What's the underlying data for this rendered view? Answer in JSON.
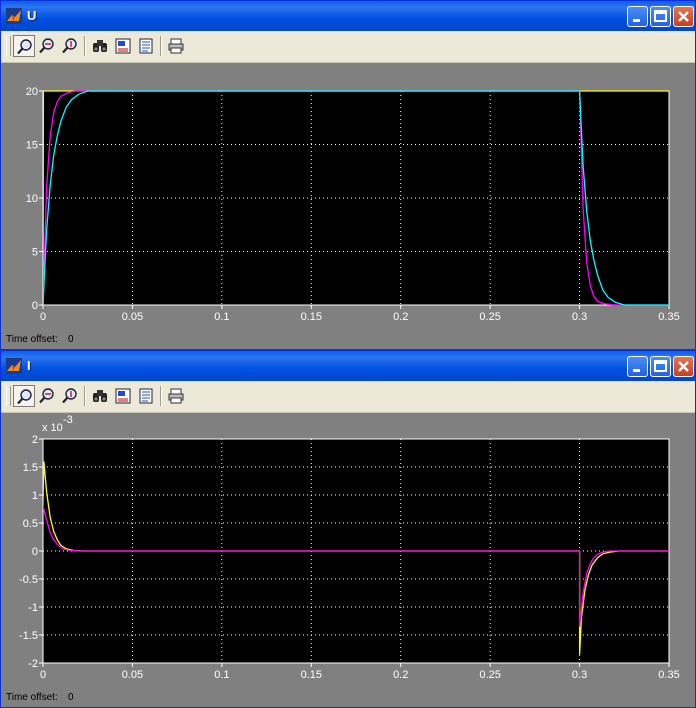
{
  "windows": [
    {
      "title": "U",
      "toolbar": [
        "zoom-icon",
        "zoom-x-icon",
        "zoom-y-icon",
        "autoscale-icon",
        "save-axes-icon",
        "parameters-icon",
        "print-icon"
      ],
      "time_offset_label": "Time offset:",
      "time_offset_value": "0"
    },
    {
      "title": "I",
      "toolbar": [
        "zoom-icon",
        "zoom-x-icon",
        "zoom-y-icon",
        "autoscale-icon",
        "save-axes-icon",
        "parameters-icon",
        "print-icon"
      ],
      "time_offset_label": "Time offset:",
      "time_offset_value": "0"
    }
  ],
  "colors": {
    "bg": "#000000",
    "grid": "#ffffff",
    "yellow": "#ffff00",
    "magenta": "#ff00ff",
    "cyan": "#00ffff"
  },
  "chart_data": [
    {
      "type": "line",
      "title": "U",
      "xlim": [
        0,
        0.35
      ],
      "ylim": [
        0,
        20
      ],
      "xticks": [
        0,
        0.05,
        0.1,
        0.15,
        0.2,
        0.25,
        0.3,
        0.35
      ],
      "xtick_labels": [
        "0",
        "0.05",
        "0.1",
        "0.15",
        "0.2",
        "0.25",
        "0.3",
        "0.35"
      ],
      "yticks": [
        0,
        5,
        10,
        15,
        20
      ],
      "ytick_labels": [
        "0",
        "5",
        "10",
        "15",
        "20"
      ],
      "grid": true,
      "series": [
        {
          "color": "#ffff00",
          "x": [
            0,
            0.0002,
            0.3,
            0.3,
            0.35
          ],
          "y": [
            0,
            20,
            20,
            20,
            20
          ]
        },
        {
          "color": "#ff00ff",
          "x": [
            0,
            0.002,
            0.004,
            0.006,
            0.008,
            0.01,
            0.014,
            0.018,
            0.3,
            0.302,
            0.304,
            0.306,
            0.308,
            0.31,
            0.314,
            0.318,
            0.322,
            0.35
          ],
          "y": [
            0,
            11,
            15.8,
            18,
            19,
            19.5,
            19.85,
            20,
            20,
            9,
            4,
            1.8,
            0.8,
            0.35,
            0.1,
            0.03,
            0,
            0
          ]
        },
        {
          "color": "#00ffff",
          "x": [
            0,
            0.002,
            0.004,
            0.006,
            0.008,
            0.01,
            0.013,
            0.016,
            0.02,
            0.025,
            0.3,
            0.302,
            0.304,
            0.306,
            0.308,
            0.31,
            0.313,
            0.316,
            0.32,
            0.325,
            0.35
          ],
          "y": [
            0,
            7,
            11.2,
            14,
            15.8,
            17.2,
            18.5,
            19.2,
            19.7,
            20,
            20,
            13,
            8.8,
            6,
            4.2,
            2.8,
            1.4,
            0.7,
            0.25,
            0,
            0
          ]
        }
      ]
    },
    {
      "type": "line",
      "title": "I",
      "xlim": [
        0,
        0.35
      ],
      "ylim": [
        -2,
        2
      ],
      "exponent_label": "x 10",
      "exponent_power": "-3",
      "xticks": [
        0,
        0.05,
        0.1,
        0.15,
        0.2,
        0.25,
        0.3,
        0.35
      ],
      "xtick_labels": [
        "0",
        "0.05",
        "0.1",
        "0.15",
        "0.2",
        "0.25",
        "0.3",
        "0.35"
      ],
      "yticks": [
        2,
        1.5,
        1,
        0.5,
        0,
        -0.5,
        -1,
        -1.5,
        -2
      ],
      "ytick_labels": [
        "2",
        "1.5",
        "1",
        "0.5",
        "0",
        "-0.5",
        "-1",
        "-1.5",
        "-2"
      ],
      "grid": true,
      "series": [
        {
          "color": "#ffff00",
          "x": [
            0,
            0.0005,
            0.002,
            0.004,
            0.006,
            0.008,
            0.01,
            0.013,
            0.017,
            0.022,
            0.17,
            0.3,
            0.3,
            0.301,
            0.303,
            0.305,
            0.307,
            0.31,
            0.313,
            0.317,
            0.322,
            0.35
          ],
          "y": [
            0.9,
            1.6,
            1.05,
            0.6,
            0.35,
            0.2,
            0.1,
            0.04,
            0.01,
            0,
            0,
            0,
            -1.85,
            -1.2,
            -0.7,
            -0.42,
            -0.25,
            -0.12,
            -0.05,
            -0.02,
            0,
            0
          ]
        },
        {
          "color": "#ff00ff",
          "x": [
            0,
            0.002,
            0.004,
            0.006,
            0.008,
            0.01,
            0.012,
            0.015,
            0.02,
            0.3,
            0.3,
            0.302,
            0.304,
            0.306,
            0.308,
            0.31,
            0.313,
            0.316,
            0.35
          ],
          "y": [
            0.8,
            0.55,
            0.33,
            0.2,
            0.12,
            0.06,
            0.03,
            0.01,
            0,
            0,
            -1.35,
            -0.75,
            -0.4,
            -0.22,
            -0.12,
            -0.06,
            -0.02,
            0,
            0
          ]
        }
      ]
    }
  ]
}
